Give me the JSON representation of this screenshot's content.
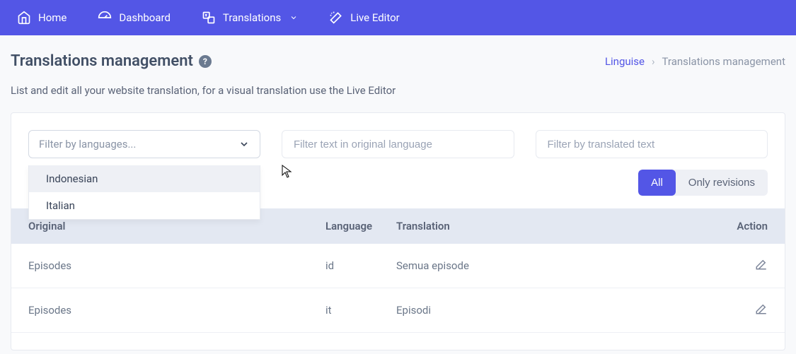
{
  "nav": {
    "home": "Home",
    "dashboard": "Dashboard",
    "translations": "Translations",
    "live_editor": "Live Editor"
  },
  "header": {
    "title": "Translations management",
    "breadcrumb_link": "Linguise",
    "breadcrumb_current": "Translations management"
  },
  "subtitle": "List and edit all your website translation, for a visual translation use the Live Editor",
  "filters": {
    "lang_placeholder": "Filter by languages...",
    "original_placeholder": "Filter text in original language",
    "translated_placeholder": "Filter by translated text",
    "dropdown": [
      "Indonesian",
      "Italian"
    ]
  },
  "toggle": {
    "all": "All",
    "revisions": "Only revisions"
  },
  "table": {
    "headers": {
      "original": "Original",
      "language": "Language",
      "translation": "Translation",
      "action": "Action"
    },
    "rows": [
      {
        "original": "Episodes",
        "language": "id",
        "translation": "Semua episode"
      },
      {
        "original": "Episodes",
        "language": "it",
        "translation": "Episodi"
      }
    ]
  }
}
